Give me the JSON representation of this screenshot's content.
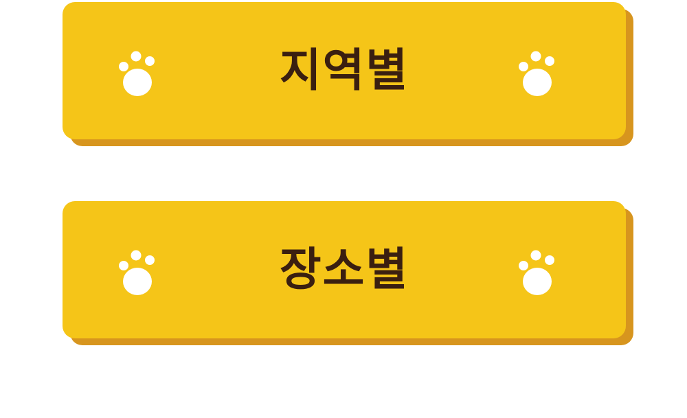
{
  "buttons": [
    {
      "label": "지역별",
      "left_icon": "paw-icon",
      "right_icon": "paw-icon"
    },
    {
      "label": "장소별",
      "left_icon": "paw-icon",
      "right_icon": "paw-icon"
    }
  ],
  "colors": {
    "button_fill": "#F5C518",
    "button_shadow": "#D7951E",
    "label_text": "#3A1F10",
    "paw": "#FFFFFF",
    "background": "#FFFFFF"
  }
}
